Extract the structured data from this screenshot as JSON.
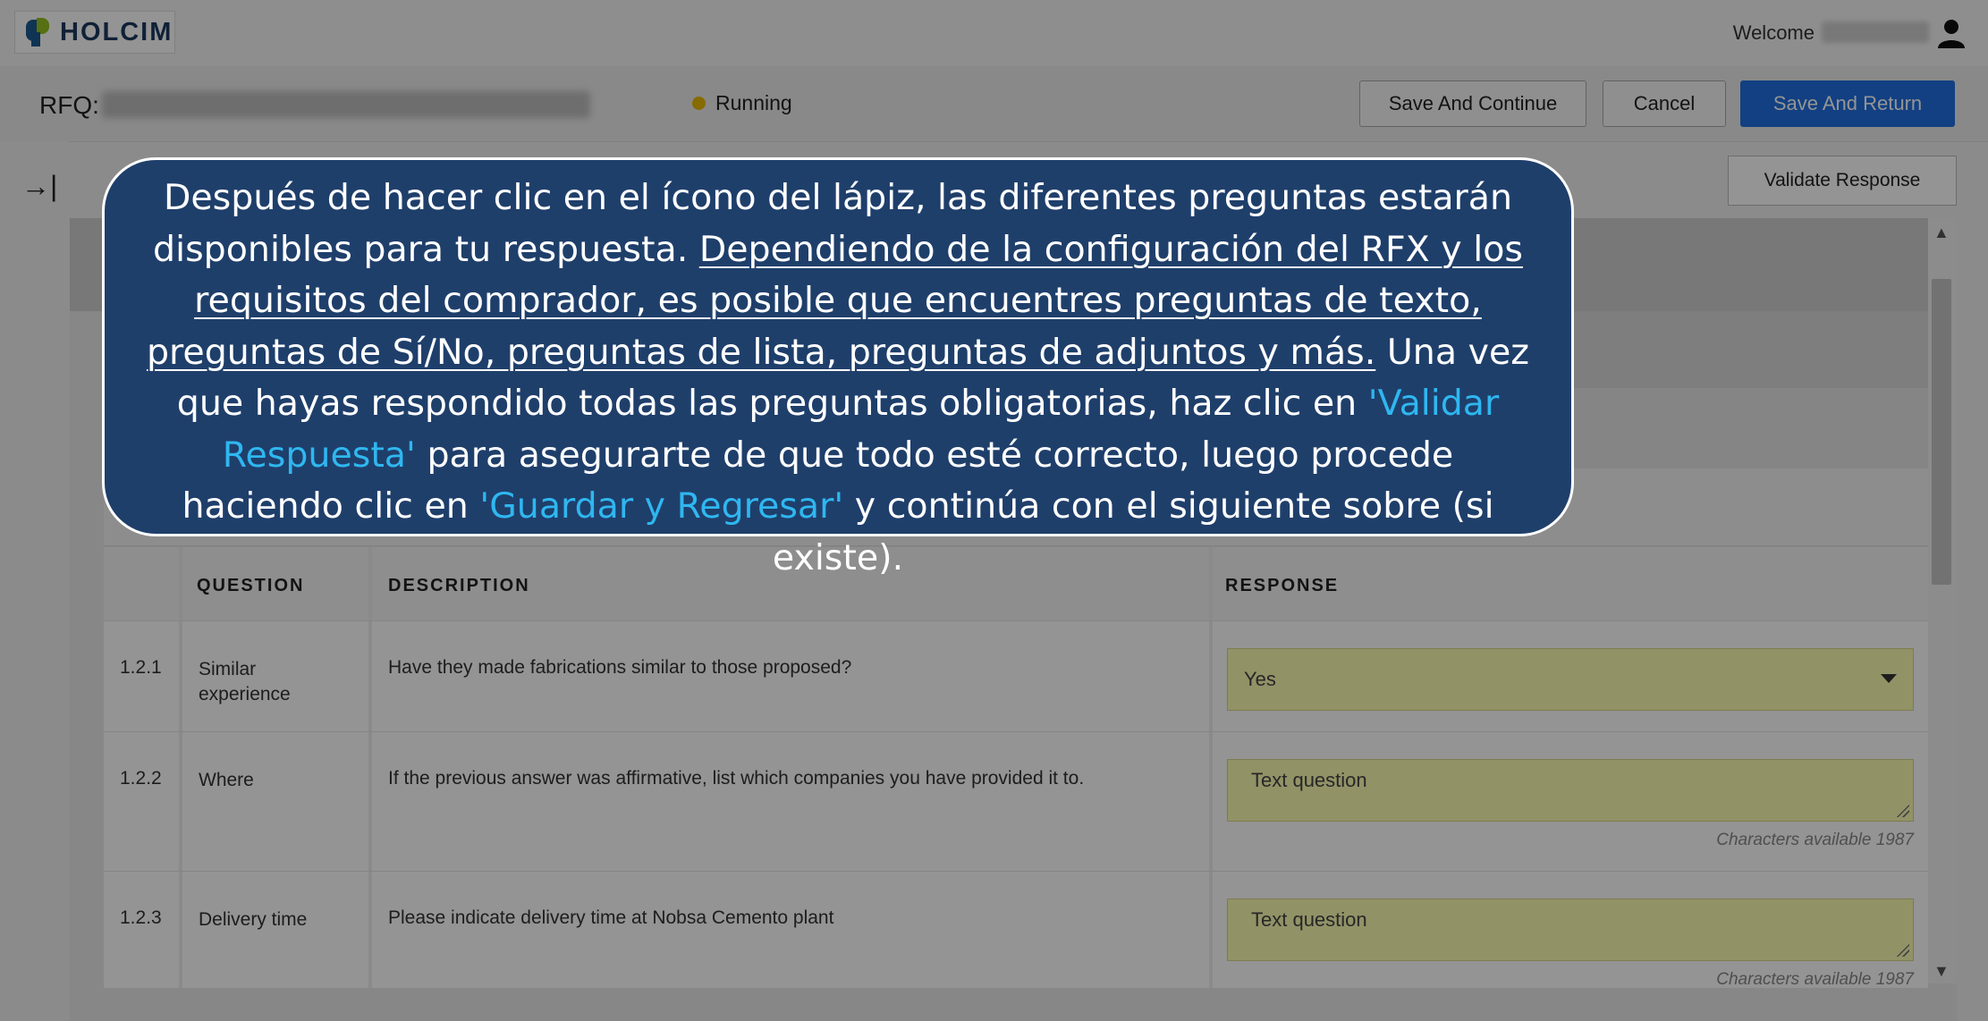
{
  "header": {
    "brand": "HOLCIM",
    "welcome": "Welcome"
  },
  "rfq": {
    "label": "RFQ:",
    "status": "Running",
    "buttons": {
      "save_continue": "Save And Continue",
      "cancel": "Cancel",
      "save_return": "Save And Return"
    },
    "validate": "Validate Response"
  },
  "sidebar": {
    "expand_icon": "→|"
  },
  "table": {
    "headers": {
      "question": "QUESTION",
      "description": "DESCRIPTION",
      "response": "RESPONSE"
    },
    "rows": [
      {
        "num": "1.2.1",
        "question": "Similar experience",
        "description": "Have they made fabrications similar to those proposed?",
        "response": "Yes"
      },
      {
        "num": "1.2.2",
        "question": "Where",
        "description": "If the previous answer was affirmative, list which companies you have provided it to.",
        "response": "Text question",
        "chars": "Characters available 1987"
      },
      {
        "num": "1.2.3",
        "question": "Delivery time",
        "description": "Please indicate delivery time at Nobsa Cemento plant",
        "response": "Text question",
        "chars": "Characters available 1987"
      }
    ]
  },
  "callout": {
    "part1": "Después de hacer clic en el ícono del lápiz, las diferentes preguntas estarán disponibles para tu respuesta.",
    "part2_underlined": "Dependiendo de la configuración del RFX y los requisitos del comprador, es posible que encuentres preguntas de texto, preguntas de Sí/No, preguntas de lista, preguntas de adjuntos y más.",
    "part3": "Una vez que hayas respondido todas las preguntas obligatorias, haz clic en",
    "highlight1": "'Validar Respuesta'",
    "part4": "para asegurarte de que todo esté correcto, luego procede haciendo clic en",
    "highlight2": "'Guardar y Regresar'",
    "part5": "y continúa con el siguiente sobre (si existe)."
  },
  "colors": {
    "primary_button": "#1f6fe0",
    "callout_bg": "#1f3f6b",
    "callout_highlight": "#2fb7f0",
    "response_bg": "#fbfbb2",
    "status_running": "#e6b800"
  }
}
